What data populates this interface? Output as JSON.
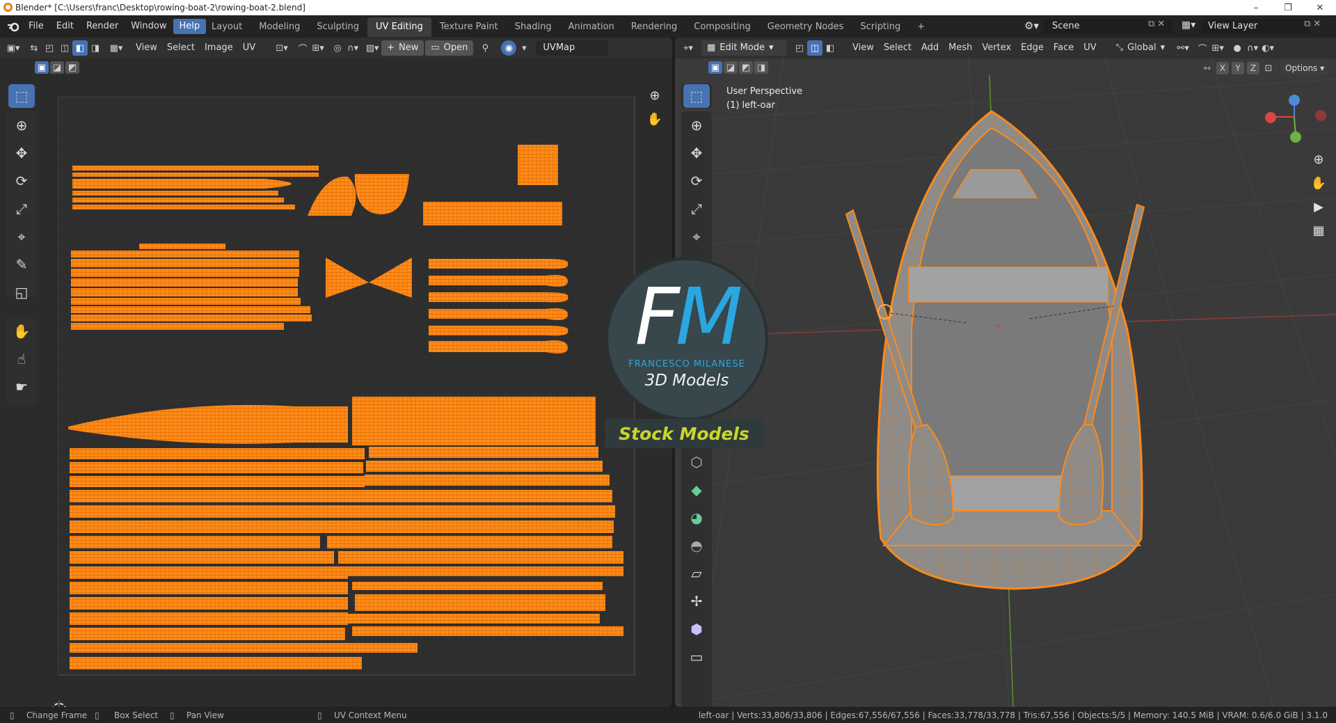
{
  "window": {
    "title": "Blender* [C:\\Users\\franc\\Desktop\\rowing-boat-2\\rowing-boat-2.blend]",
    "controls": [
      "–",
      "❐",
      "✕"
    ]
  },
  "menus": [
    "File",
    "Edit",
    "Render",
    "Window",
    "Help"
  ],
  "workspaces": [
    "Layout",
    "Modeling",
    "Sculpting",
    "UV Editing",
    "Texture Paint",
    "Shading",
    "Animation",
    "Rendering",
    "Compositing",
    "Geometry Nodes",
    "Scripting"
  ],
  "active_workspace": "UV Editing",
  "add_workspace": "+",
  "scene": {
    "label": "Scene"
  },
  "view_layer": {
    "label": "View Layer"
  },
  "uv_editor": {
    "menus": [
      "View",
      "Select",
      "Image",
      "UV"
    ],
    "new_label": "New",
    "open_label": "Open",
    "uvmap": "UVMap"
  },
  "viewport": {
    "mode": "Edit Mode",
    "menus": [
      "View",
      "Select",
      "Add",
      "Mesh",
      "Vertex",
      "Edge",
      "Face",
      "UV"
    ],
    "orientation": "Global",
    "axes": [
      "X",
      "Y",
      "Z"
    ],
    "options_label": "Options",
    "overlay_line1": "User Perspective",
    "overlay_line2": "(1) left-oar",
    "gizmo": {
      "x": "X",
      "y": "Y",
      "z": "Z"
    }
  },
  "watermark": {
    "letters": "FM",
    "name": "FRANCESCO MILANESE",
    "sub": "3D Models",
    "stock": "Stock Models"
  },
  "status": {
    "left": [
      {
        "label": "Change Frame"
      },
      {
        "label": "Box Select"
      },
      {
        "label": "Pan View"
      },
      {
        "label": "UV Context Menu"
      }
    ],
    "right": "left-oar | Verts:33,806/33,806 | Edges:67,556/67,556 | Faces:33,778/33,778 | Tris:67,556 | Objects:5/5 | Memory: 140.5 MiB | VRAM: 0.6/6.0 GiB | 3.1.0"
  },
  "colors": {
    "accent": "#4772b3",
    "uv_orange": "#ff8c1a",
    "panel": "#303030",
    "canvas": "#2b2b2b"
  }
}
